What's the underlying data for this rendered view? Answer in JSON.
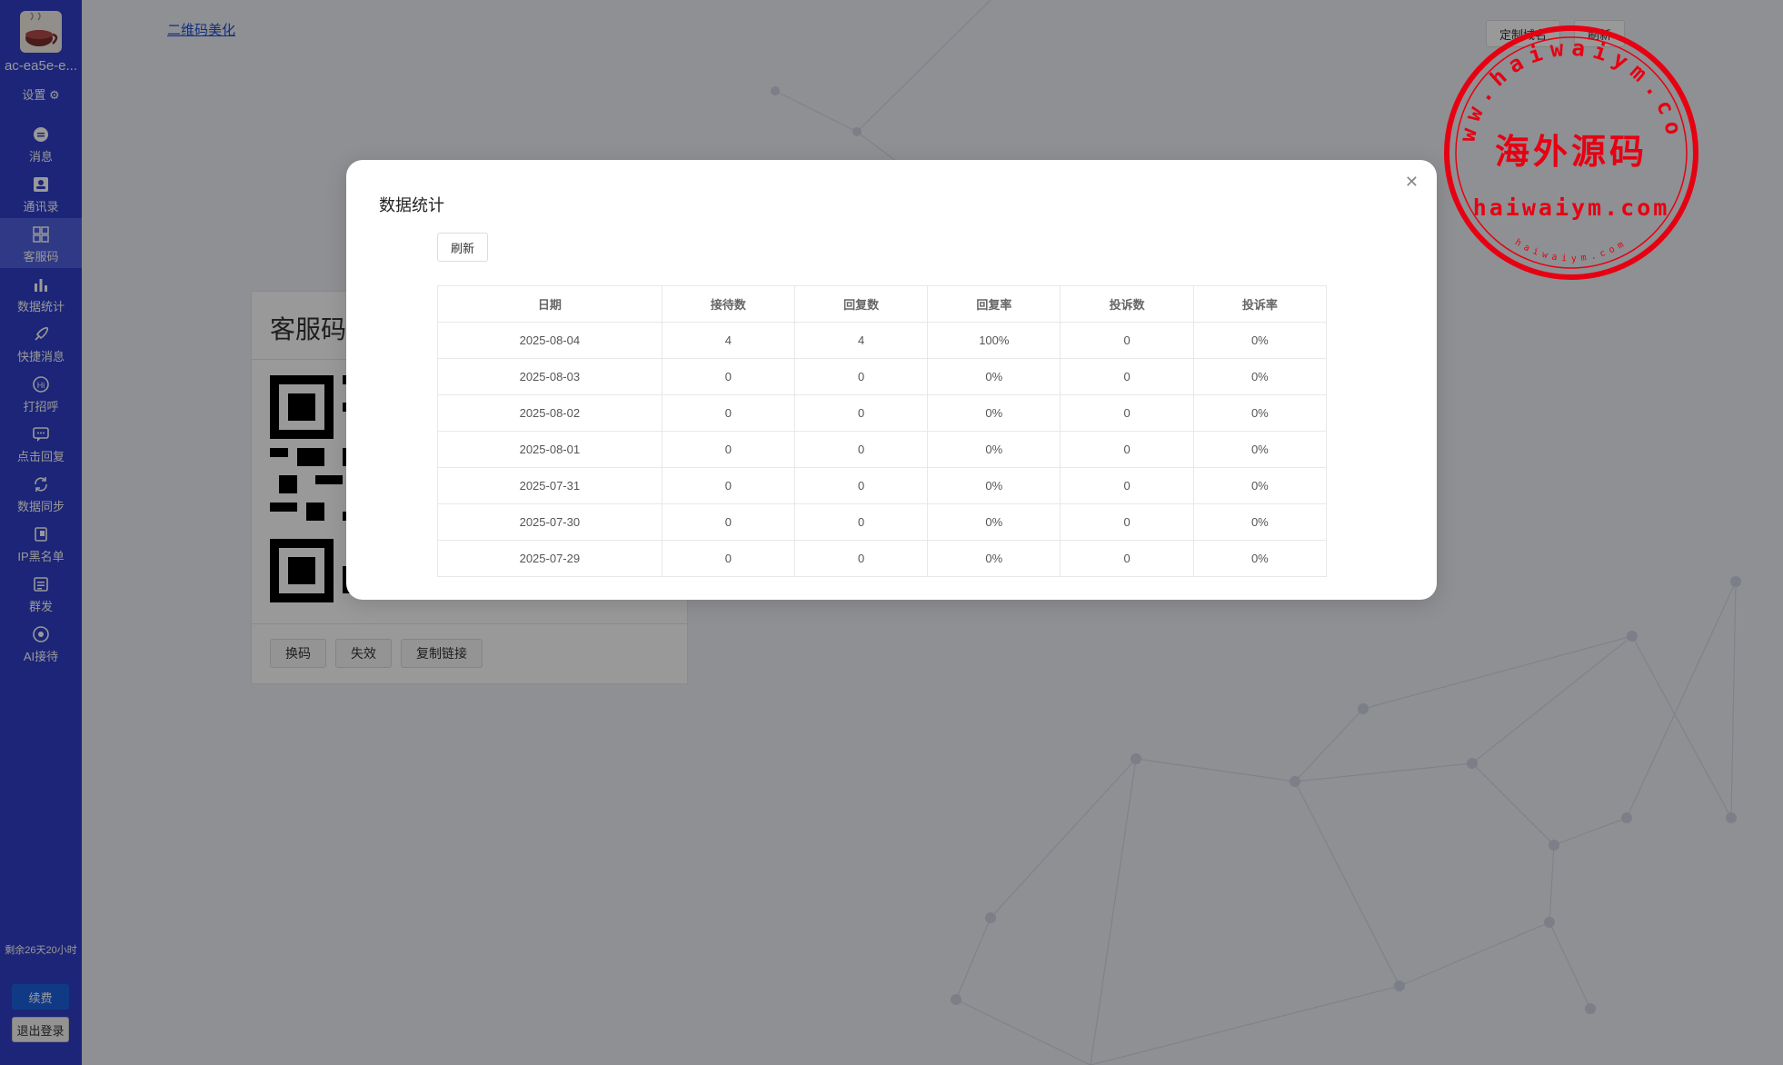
{
  "sidebar": {
    "account": "ac-ea5e-e...",
    "settings_label": "设置",
    "items": [
      {
        "label": "消息",
        "icon": "chat-icon"
      },
      {
        "label": "通讯录",
        "icon": "contacts-icon"
      },
      {
        "label": "客服码",
        "icon": "qrcode-icon"
      },
      {
        "label": "数据统计",
        "icon": "bar-chart-icon"
      },
      {
        "label": "快捷消息",
        "icon": "rocket-icon"
      },
      {
        "label": "打招呼",
        "icon": "hi-icon"
      },
      {
        "label": "点击回复",
        "icon": "message-icon"
      },
      {
        "label": "数据同步",
        "icon": "sync-icon"
      },
      {
        "label": "IP黑名单",
        "icon": "block-icon"
      },
      {
        "label": "群发",
        "icon": "broadcast-icon"
      },
      {
        "label": "AI接待",
        "icon": "ai-icon"
      }
    ],
    "active_index": 2,
    "remaining": "剩余26天20小时",
    "renew_label": "续费",
    "logout_label": "退出登录"
  },
  "page": {
    "beautify_link": "二维码美化",
    "custom_domain_label": "定制域名",
    "refresh_label": "刷新",
    "card_title": "客服码",
    "card_buttons": [
      "换码",
      "失效",
      "复制链接"
    ]
  },
  "modal": {
    "title": "数据统计",
    "refresh_label": "刷新",
    "columns": [
      "日期",
      "接待数",
      "回复数",
      "回复率",
      "投诉数",
      "投诉率"
    ],
    "rows": [
      [
        "2025-08-04",
        "4",
        "4",
        "100%",
        "0",
        "0%"
      ],
      [
        "2025-08-03",
        "0",
        "0",
        "0%",
        "0",
        "0%"
      ],
      [
        "2025-08-02",
        "0",
        "0",
        "0%",
        "0",
        "0%"
      ],
      [
        "2025-08-01",
        "0",
        "0",
        "0%",
        "0",
        "0%"
      ],
      [
        "2025-07-31",
        "0",
        "0",
        "0%",
        "0",
        "0%"
      ],
      [
        "2025-07-30",
        "0",
        "0",
        "0%",
        "0",
        "0%"
      ],
      [
        "2025-07-29",
        "0",
        "0",
        "0%",
        "0",
        "0%"
      ]
    ]
  },
  "watermark": {
    "ring_text": "www.haiwaiym.com",
    "center_text": "海外源码",
    "bottom_text": "haiwaiym.com",
    "small_text": "haiwaiym.com",
    "color": "#e60012"
  }
}
